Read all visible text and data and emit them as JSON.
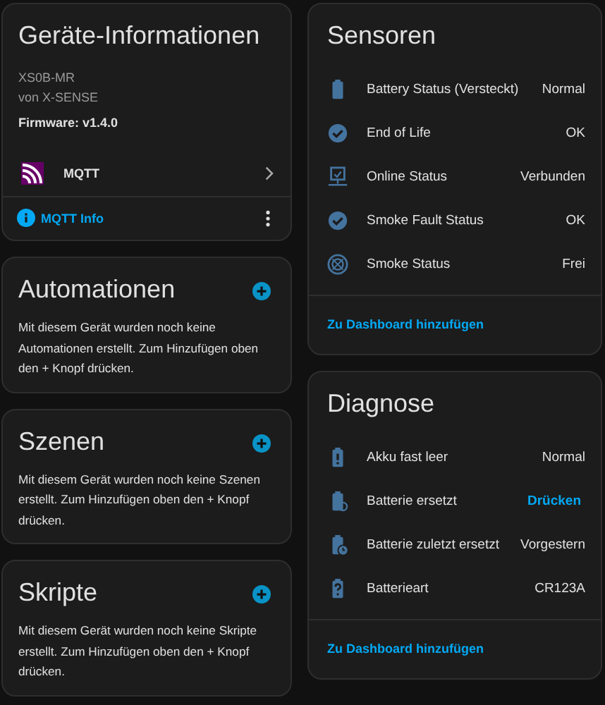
{
  "device_info": {
    "title": "Geräte-Informationen",
    "model": "XS0B-MR",
    "manufacturer": "von X-SENSE",
    "firmware": "Firmware: v1.4.0",
    "integration": {
      "label": "MQTT"
    },
    "info_link": "MQTT Info"
  },
  "sections": [
    {
      "title": "Automationen",
      "text": "Mit diesem Gerät wurden noch keine Automationen erstellt. Zum Hinzufügen oben den + Knopf drücken."
    },
    {
      "title": "Szenen",
      "text": "Mit diesem Gerät wurden noch keine Szenen erstellt. Zum Hinzufügen oben den + Knopf drücken."
    },
    {
      "title": "Skripte",
      "text": "Mit diesem Gerät wurden noch keine Skripte erstellt. Zum Hinzufügen oben den + Knopf drücken."
    }
  ],
  "sensors": {
    "title": "Sensoren",
    "rows": [
      {
        "kind": "battery",
        "name": "Battery Status (Versteckt)",
        "pressable": false,
        "value": "Normal"
      },
      {
        "kind": "check",
        "name": "End of Life",
        "pressable": false,
        "value": "OK"
      },
      {
        "kind": "monitor",
        "name": "Online Status",
        "pressable": false,
        "value": "Verbunden"
      },
      {
        "kind": "check",
        "name": "Smoke Fault Status",
        "pressable": false,
        "value": "OK"
      },
      {
        "kind": "smoke",
        "name": "Smoke Status",
        "pressable": false,
        "value": "Frei"
      }
    ],
    "link": "Zu Dashboard hinzufügen"
  },
  "diagnostics": {
    "title": "Diagnose",
    "rows": [
      {
        "kind": "alert",
        "name": "Akku fast leer",
        "pressable": false,
        "value": "Normal"
      },
      {
        "kind": "sync",
        "name": "Batterie ersetzt",
        "pressable": true,
        "value": "Drücken"
      },
      {
        "kind": "clock",
        "name": "Batterie zuletzt ersetzt",
        "pressable": false,
        "value": "Vorgestern"
      },
      {
        "kind": "unknown",
        "name": "Batterieart",
        "pressable": false,
        "value": "CR123A"
      }
    ],
    "link": "Zu Dashboard hinzufügen"
  }
}
